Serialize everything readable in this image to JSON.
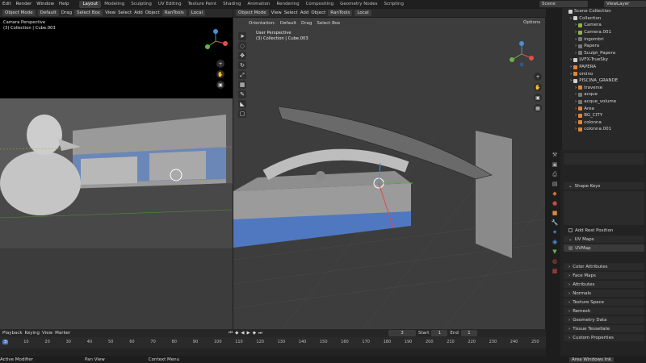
{
  "topbar": {
    "menus": [
      "Edit",
      "Render",
      "Window",
      "Help"
    ],
    "workspaces": [
      "Layout",
      "Modeling",
      "Sculpting",
      "UV Editing",
      "Texture Paint",
      "Shading",
      "Animation",
      "Rendering",
      "Compositing",
      "Geometry Nodes",
      "Scripting"
    ],
    "active_workspace": "Layout",
    "scene_label": "Scene",
    "viewlayer_label": "ViewLayer"
  },
  "left_viewport": {
    "header": {
      "mode": "Object Mode",
      "orientation": "Default",
      "drag": "Drag",
      "select": "Select Box",
      "menus": [
        "View",
        "Select",
        "Add",
        "Object"
      ],
      "addon": "RanTools",
      "transform": "Local"
    },
    "overlay_title": "Camera Perspective",
    "overlay_subtitle": "(3) Collection | Cube.003"
  },
  "right_viewport": {
    "header": {
      "mode": "Object Mode",
      "orientation_label": "Orientation:",
      "orientation": "Default",
      "drag": "Drag",
      "select": "Select Box",
      "menus": [
        "View",
        "Select",
        "Add",
        "Object"
      ],
      "addon": "RanTools",
      "transform": "Local",
      "options": "Options"
    },
    "overlay_title": "User Perspective",
    "overlay_subtitle": "(3) Collection | Cube.003"
  },
  "outliner": {
    "title": "Scene Collection",
    "items": [
      {
        "name": "Collection",
        "color": "#d0d0d0",
        "indent": 1
      },
      {
        "name": "Camera",
        "color": "#8fb34a",
        "indent": 2
      },
      {
        "name": "Camera.001",
        "color": "#8fb34a",
        "indent": 2
      },
      {
        "name": "ingombri",
        "color": "#777777",
        "indent": 2
      },
      {
        "name": "Papera",
        "color": "#777777",
        "indent": 2
      },
      {
        "name": "Sculpt_Papera",
        "color": "#777777",
        "indent": 2
      },
      {
        "name": "LVFX-TrueSky",
        "color": "#d0d0d0",
        "indent": 1
      },
      {
        "name": "PAPERA",
        "color": "#e0863b",
        "indent": 1
      },
      {
        "name": "omino",
        "color": "#e0863b",
        "indent": 1
      },
      {
        "name": "PISCINA_GRANDE",
        "color": "#d0d0d0",
        "indent": 1
      },
      {
        "name": "traverse",
        "color": "#e0863b",
        "indent": 2
      },
      {
        "name": "acque",
        "color": "#777777",
        "indent": 2
      },
      {
        "name": "acque_volume",
        "color": "#777777",
        "indent": 2
      },
      {
        "name": "Area",
        "color": "#e0863b",
        "indent": 2
      },
      {
        "name": "BG_CITY",
        "color": "#e0863b",
        "indent": 2
      },
      {
        "name": "colonna",
        "color": "#e0863b",
        "indent": 2
      },
      {
        "name": "colonna.001",
        "color": "#e0863b",
        "indent": 2
      }
    ]
  },
  "properties": {
    "panels": [
      "Shape Keys",
      "Add Rest Position",
      "UV Maps",
      "UVMap",
      "Color Attributes",
      "Face Maps",
      "Attributes",
      "Normals",
      "Texture Space",
      "Remesh",
      "Geometry Data",
      "Tissue Tessellate",
      "Custom Properties"
    ]
  },
  "timeline": {
    "menus": [
      "Playback",
      "Keying",
      "View",
      "Marker"
    ],
    "current_frame": "3",
    "start_label": "Start",
    "start": "1",
    "end_label": "End",
    "end": "1",
    "frames": [
      "3",
      "10",
      "20",
      "30",
      "40",
      "50",
      "60",
      "70",
      "80",
      "90",
      "100",
      "110",
      "120",
      "130",
      "140",
      "150",
      "160",
      "170",
      "180",
      "190",
      "200",
      "210",
      "220",
      "230",
      "240",
      "250"
    ]
  },
  "statusbar": {
    "items": [
      "Active Modifier",
      "Pan View",
      "Context Menu"
    ],
    "watermark": "Area Windows Ink"
  }
}
